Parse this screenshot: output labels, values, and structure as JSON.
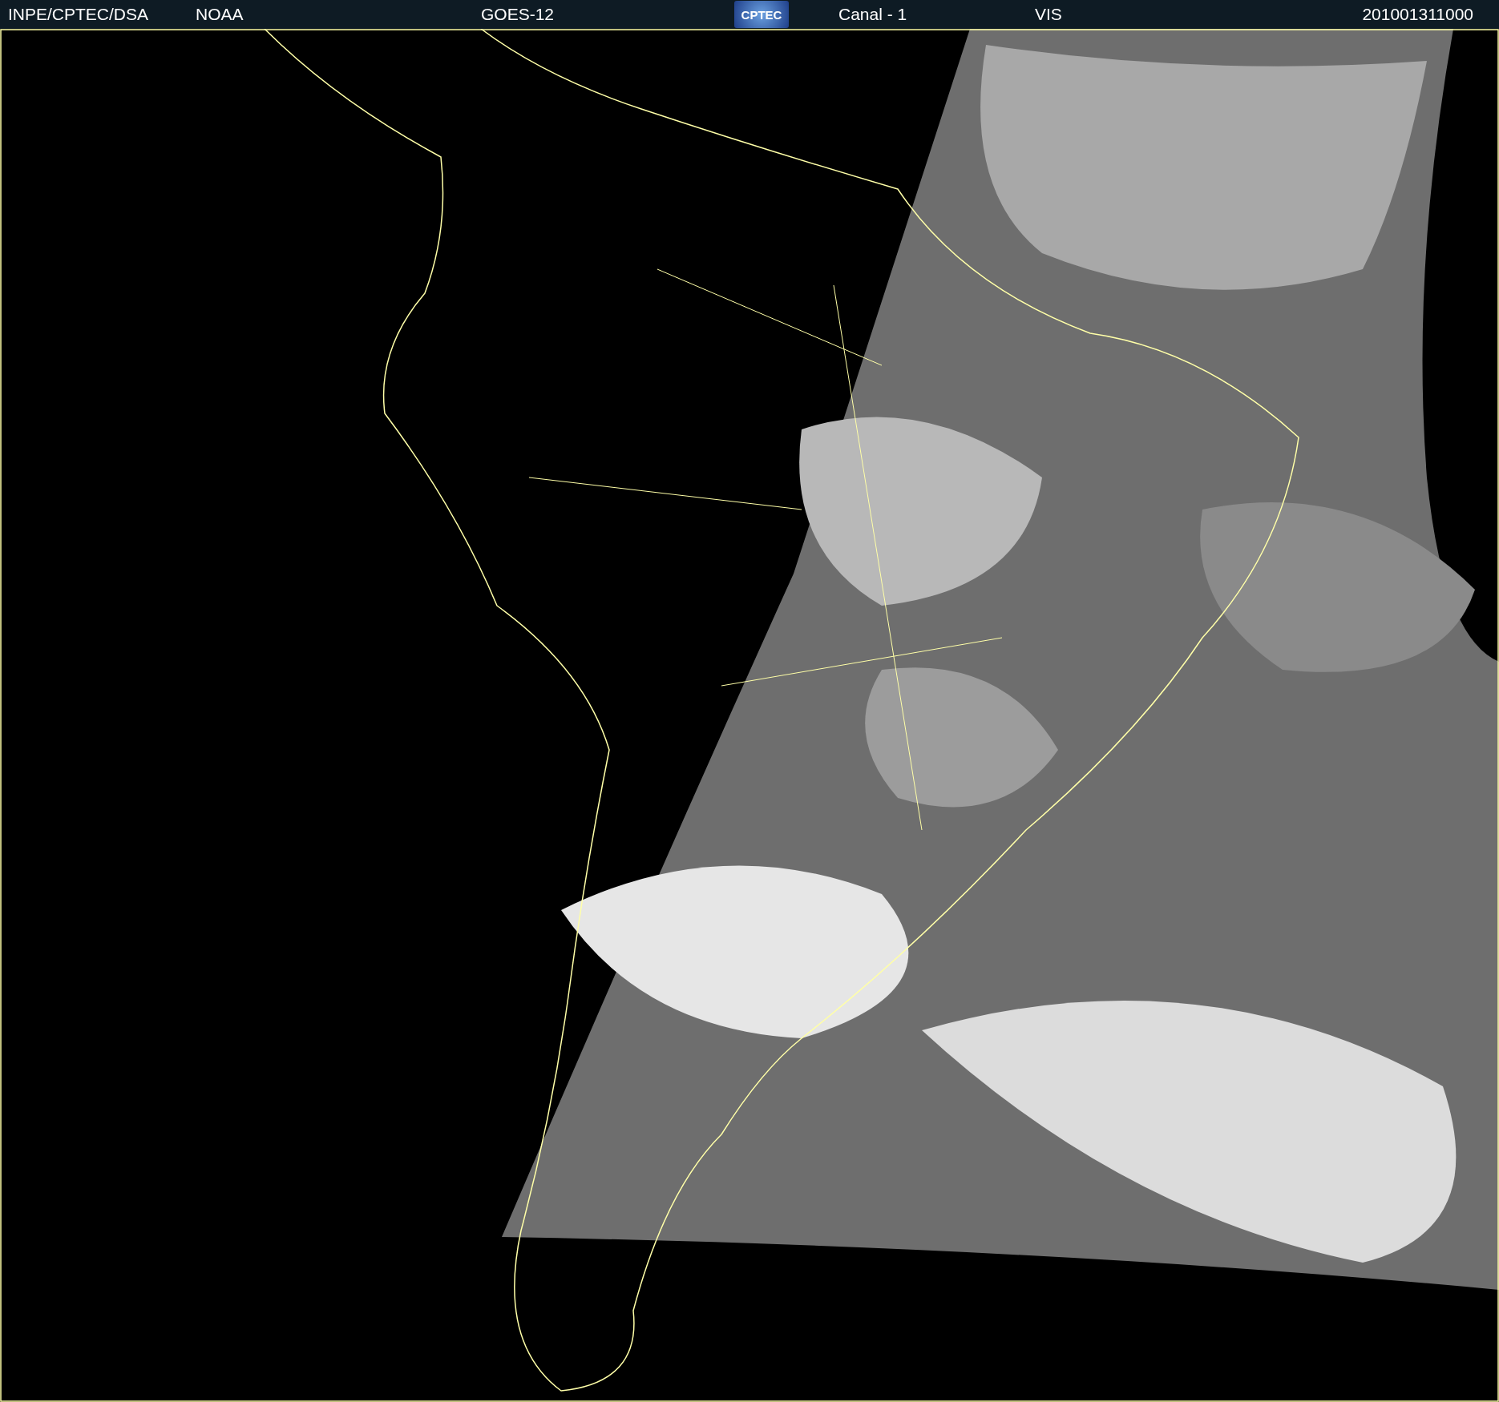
{
  "header": {
    "agency": "INPE/CPTEC/DSA",
    "source": "NOAA",
    "satellite": "GOES-12",
    "logo": "CPTEC",
    "channel": "Canal - 1",
    "band": "VIS",
    "timestamp": "201001311000"
  }
}
